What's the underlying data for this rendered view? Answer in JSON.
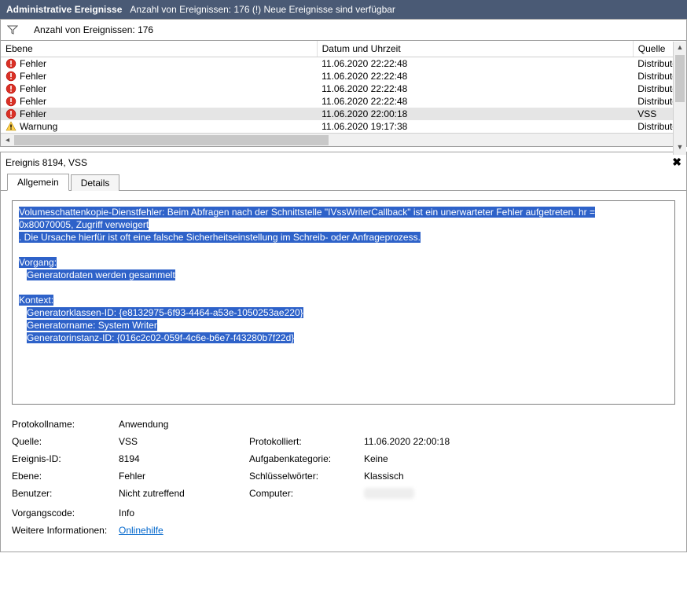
{
  "titlebar": {
    "title": "Administrative Ereignisse",
    "subtitle": "Anzahl von Ereignissen: 176 (!) Neue Ereignisse sind verfügbar"
  },
  "filterbar": {
    "count": "Anzahl von Ereignissen: 176"
  },
  "columns": {
    "level": "Ebene",
    "datetime": "Datum und Uhrzeit",
    "source": "Quelle"
  },
  "rows": [
    {
      "level": "Fehler",
      "icon": "error",
      "dt": "11.06.2020 22:22:48",
      "src": "Distributed",
      "sel": false
    },
    {
      "level": "Fehler",
      "icon": "error",
      "dt": "11.06.2020 22:22:48",
      "src": "Distributed",
      "sel": false
    },
    {
      "level": "Fehler",
      "icon": "error",
      "dt": "11.06.2020 22:22:48",
      "src": "Distributed",
      "sel": false
    },
    {
      "level": "Fehler",
      "icon": "error",
      "dt": "11.06.2020 22:22:48",
      "src": "Distributed",
      "sel": false
    },
    {
      "level": "Fehler",
      "icon": "error",
      "dt": "11.06.2020 22:00:18",
      "src": "VSS",
      "sel": true
    },
    {
      "level": "Warnung",
      "icon": "warn",
      "dt": "11.06.2020 19:17:38",
      "src": "Distributed",
      "sel": false
    }
  ],
  "detail": {
    "header": "Ereignis 8194, VSS",
    "tabs": {
      "general": "Allgemein",
      "details": "Details"
    },
    "message": {
      "l1a": "Volumeschattenkopie-Dienstfehler: Beim Abfragen nach der Schnittstelle \"IVssWriterCallback\" ist ein unerwarteter Fehler aufgetreten. hr = ",
      "l1b": "0x80070005, Zugriff verweigert",
      "l2": ". Die Ursache hierfür ist oft eine falsche Sicherheitseinstellung im Schreib- oder Anfrageprozess.",
      "l3": "Vorgang:",
      "l4": "Generatordaten werden gesammelt",
      "l5": "Kontext:",
      "l6": "Generatorklassen-ID: {e8132975-6f93-4464-a53e-1050253ae220}",
      "l7": "Generatorname: System Writer",
      "l8": "Generatorinstanz-ID: {016c2c02-059f-4c6e-b6e7-f43280b7f22d}"
    },
    "meta_labels": {
      "log": "Protokollname:",
      "source": "Quelle:",
      "logged": "Protokolliert:",
      "eventid": "Ereignis-ID:",
      "taskcat": "Aufgabenkategorie:",
      "level": "Ebene:",
      "keywords": "Schlüsselwörter:",
      "user": "Benutzer:",
      "computer": "Computer:",
      "opcode": "Vorgangscode:",
      "moreinfo": "Weitere Informationen:"
    },
    "meta_values": {
      "log": "Anwendung",
      "source": "VSS",
      "logged": "11.06.2020 22:00:18",
      "eventid": "8194",
      "taskcat": "Keine",
      "level": "Fehler",
      "keywords": "Klassisch",
      "user": "Nicht zutreffend",
      "opcode": "Info",
      "moreinfo": "Onlinehilfe"
    }
  }
}
